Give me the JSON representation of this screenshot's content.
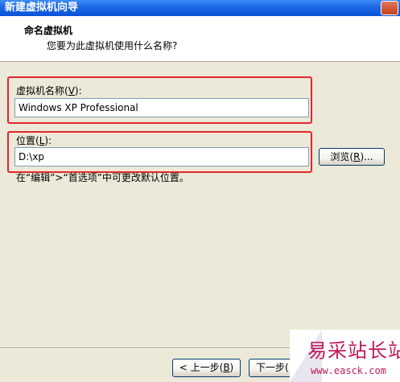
{
  "window": {
    "title": "新建虚拟机向导"
  },
  "header": {
    "title": "命名虚拟机",
    "subtitle": "您要为此虚拟机使用什么名称?"
  },
  "name_field": {
    "label_prefix": "虚拟机名称(",
    "label_key": "V",
    "label_suffix": "):",
    "value": "Windows XP Professional"
  },
  "location_field": {
    "label_prefix": "位置(",
    "label_key": "L",
    "label_suffix": "):",
    "value": "D:\\xp"
  },
  "browse_button": {
    "label_prefix": "浏览(",
    "label_key": "R",
    "label_suffix": ")..."
  },
  "hint": "在“编辑”>“首选项”中可更改默认位置。",
  "footer": {
    "back_prefix": "< 上一步(",
    "back_key": "B",
    "back_suffix": ")",
    "next_label": "下一步("
  },
  "watermark": {
    "text": "易采站长站",
    "url": "www.easck.com"
  },
  "colors": {
    "highlight_border": "#e3262c",
    "title_bar": "#0a52d6",
    "dialog_bg": "#ece9d8"
  }
}
